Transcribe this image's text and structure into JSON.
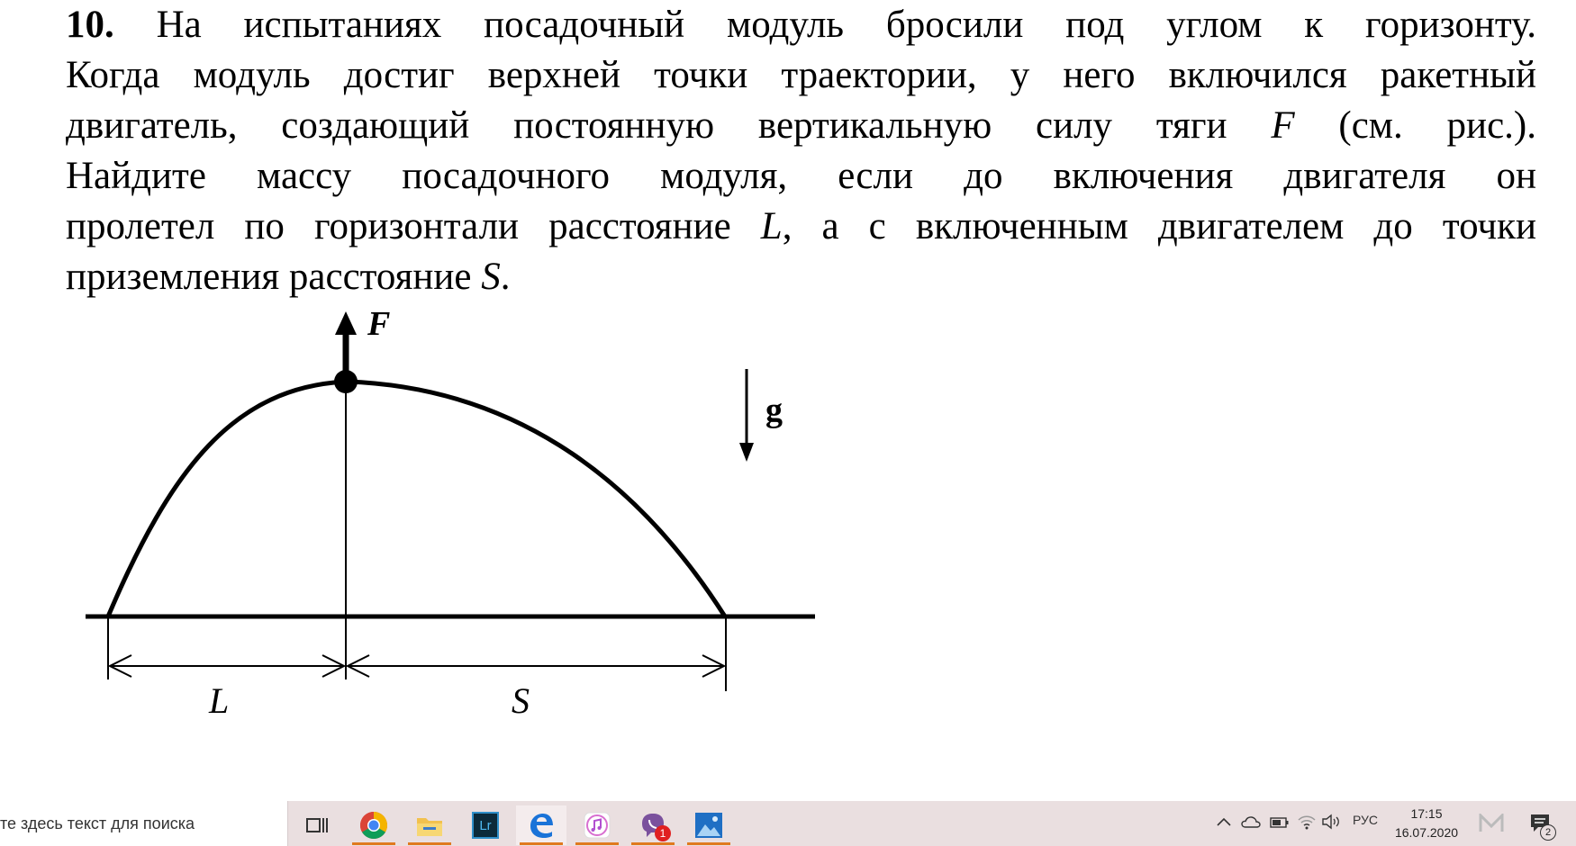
{
  "problem": {
    "number": "10.",
    "lines": [
      " На испытаниях посадочный модуль бросили под углом к горизонту.",
      "Когда модуль достиг верхней точки траектории, у него включился ракетный",
      "двигатель, создающий постоянную вертикальную силу тяги ",
      "Найдите массу посадочного модуля, если до включения двигателя он",
      "пролетел по горизонтали расстояние ",
      "приземления расстояние "
    ],
    "line3_tail": " (см. рис.).",
    "line5_tail": ", а с включенным двигателем до точки",
    "line6_tail": ".",
    "var_F": "F",
    "var_L": "L",
    "var_S": "S"
  },
  "figure": {
    "force_label": "F",
    "gravity_label": "g",
    "dim_L_label": "L",
    "dim_S_label": "S"
  },
  "taskbar": {
    "search_text": "те здесь текст для поиска",
    "icons": [
      "task-view-icon",
      "chrome-icon",
      "file-explorer-icon",
      "lightroom-icon",
      "edge-icon",
      "itunes-icon",
      "viber-icon",
      "photos-icon"
    ],
    "lightroom_label": "Lr",
    "viber_badge": "1",
    "language": "РУС",
    "time": "17:15",
    "date": "16.07.2020",
    "notifications_count": "2"
  }
}
